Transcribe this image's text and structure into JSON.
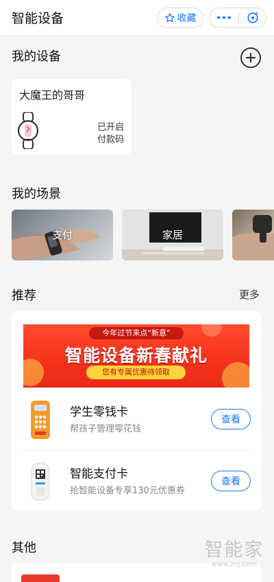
{
  "header": {
    "title": "智能设备",
    "favorite_label": "收藏",
    "more_icon": "ellipsis-icon",
    "close_icon": "close-circle-icon"
  },
  "my_devices": {
    "title": "我的设备",
    "add_icon": "plus-circle-icon",
    "device": {
      "name": "大魔王的哥哥",
      "status_line1": "已开启",
      "status_line2": "付款码",
      "icon": "smartwatch-icon"
    }
  },
  "my_scenes": {
    "title": "我的场景",
    "items": [
      {
        "label": "支付"
      },
      {
        "label": "家居"
      },
      {
        "label": ""
      }
    ]
  },
  "recommend": {
    "title": "推荐",
    "more": "更多",
    "banner": {
      "tag": "今年过节来点“新意”",
      "headline": "智能设备新春献礼",
      "coupon": "您有专属优惠待领取"
    },
    "items": [
      {
        "title": "学生零钱卡",
        "desc": "帮孩子管理零花钱",
        "button": "查看"
      },
      {
        "title": "智能支付卡",
        "desc": "抢智能设备专享130元优惠券",
        "button": "查看"
      }
    ]
  },
  "other": {
    "title": "其他"
  },
  "watermark": {
    "text": "智能家",
    "url": "www.znj.com"
  },
  "colors": {
    "accent": "#1677ff",
    "banner_red": "#f5321c",
    "coupon_yellow": "#ffd43b",
    "background": "#f5f5f5"
  }
}
